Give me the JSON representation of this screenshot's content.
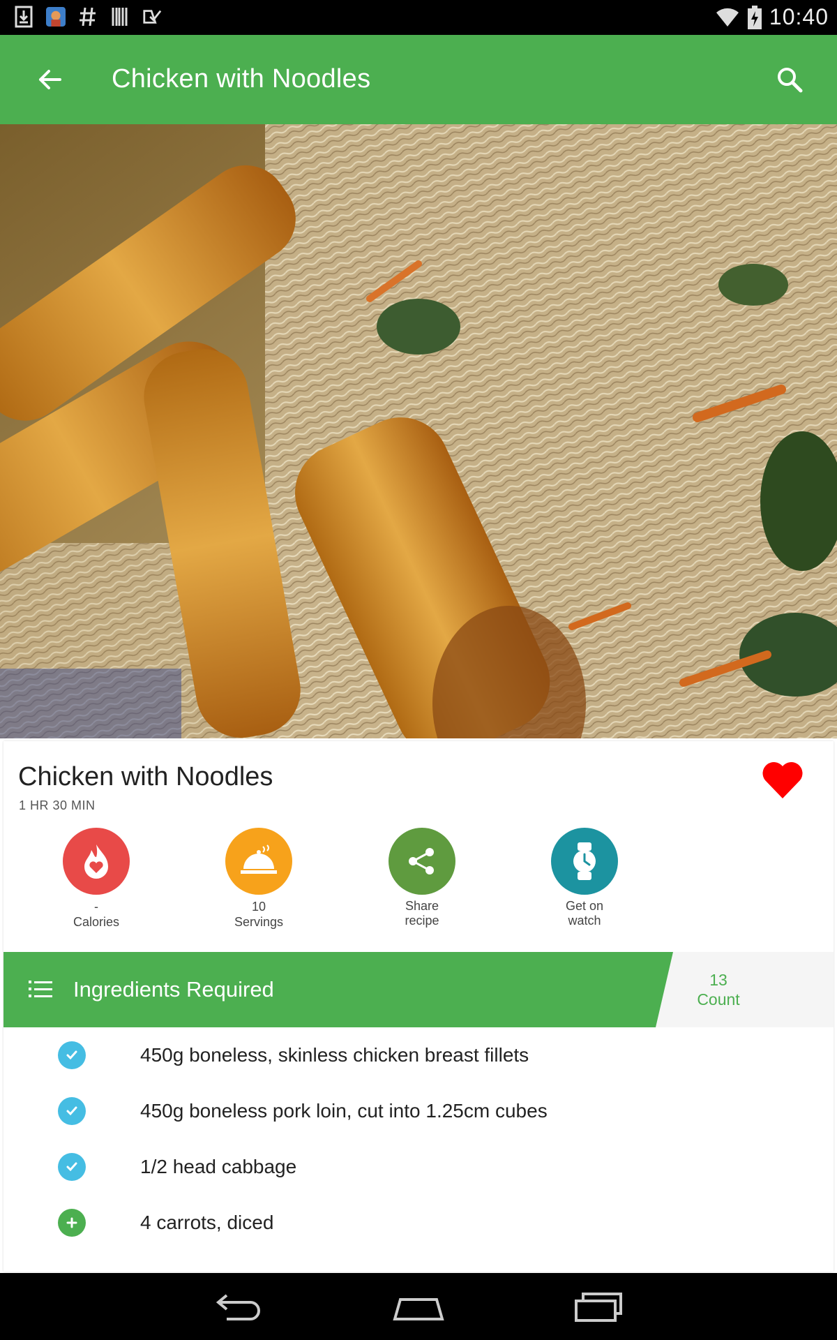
{
  "status_bar": {
    "time": "10:40",
    "left_icons": [
      "download-icon",
      "app-avatar-icon",
      "hash-icon",
      "barcode-icon",
      "check-list-icon"
    ],
    "right_icons": [
      "wifi-icon",
      "battery-charging-icon"
    ]
  },
  "app_bar": {
    "title": "Chicken with Noodles",
    "back_icon": "arrow-left-icon",
    "search_icon": "search-icon",
    "color": "#4caf50"
  },
  "hero": {
    "image": "food-photo"
  },
  "recipe": {
    "title": "Chicken with Noodles",
    "time": "1 HR 30 MIN",
    "favorite_icon": "heart-icon",
    "favorite_color": "#ff0000"
  },
  "actions": [
    {
      "value": "-",
      "label": "Calories",
      "color": "#e84a48",
      "icon": "flame-heart-icon"
    },
    {
      "value": "10",
      "label": "Servings",
      "color": "#f7a21b",
      "icon": "serving-dish-icon"
    },
    {
      "label": "Share\nrecipe",
      "color": "#5f9b3f",
      "icon": "share-icon"
    },
    {
      "label": "Get on\nwatch",
      "color": "#1c93a0",
      "icon": "watch-icon"
    }
  ],
  "ingredients": {
    "header": "Ingredients Required",
    "count_value": "13",
    "count_label": "Count",
    "items": [
      {
        "text": "450g boneless, skinless chicken breast fillets",
        "status": "checked",
        "color": "#45bde3"
      },
      {
        "text": "450g boneless pork loin, cut into 1.25cm cubes",
        "status": "checked",
        "color": "#45bde3"
      },
      {
        "text": "1/2 head cabbage",
        "status": "checked",
        "color": "#45bde3"
      },
      {
        "text": "4 carrots, diced",
        "status": "add",
        "color": "#4caf50"
      }
    ]
  },
  "nav_bar": {
    "icons": [
      "back-nav-icon",
      "home-nav-icon",
      "recents-nav-icon"
    ]
  }
}
